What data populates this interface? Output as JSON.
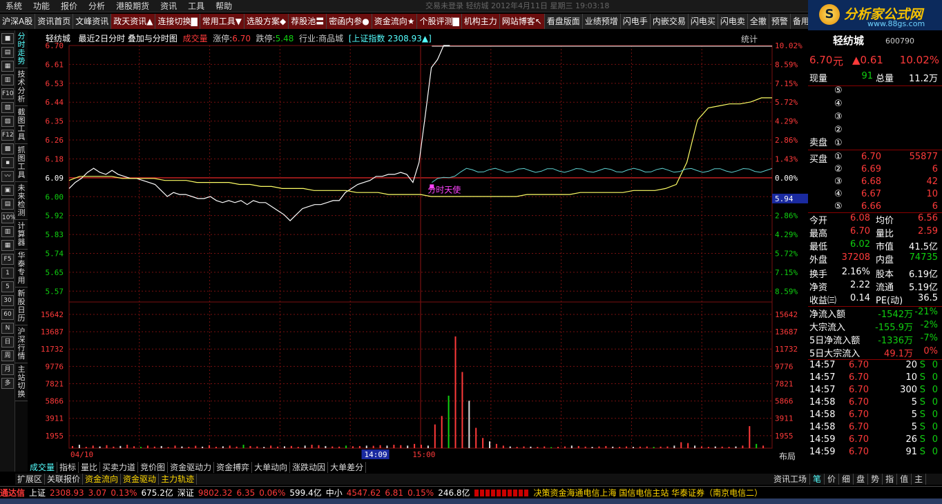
{
  "menu": [
    "系统",
    "功能",
    "报价",
    "分析",
    "港股期货",
    "资讯",
    "工具",
    "帮助"
  ],
  "window_title": "交易未登录  轻纺城  2012年4月11日  星期三  19:03:18",
  "toolbar": [
    "沪深A股",
    "资讯首页",
    "文峰资讯",
    "政天资讯▲",
    "连接切换▇",
    "常用工具▼",
    "选股方案◆",
    "荐股池〓",
    "密函内参●",
    "资金流向★",
    "个股评测▇",
    "机构主力",
    "网站博客↖",
    "看盘版面",
    "业绩预增",
    "闪电手",
    "内嵌交易",
    "闪电买",
    "闪电卖",
    "全撤",
    "预警",
    "备用"
  ],
  "logo": {
    "title": "分析家公式网",
    "url": "www.88gs.com",
    "mark": "S"
  },
  "left_icons": [
    "■",
    "▤",
    "▦",
    "▥",
    "F10",
    "▧",
    "▨",
    "F12",
    "▩",
    "▪",
    "〰",
    "▣",
    "▤",
    "10%",
    "▥",
    "▦",
    "F5",
    "1",
    "5",
    "30",
    "60",
    "N",
    "日",
    "周",
    "月",
    "多"
  ],
  "vertical_tabs": [
    "分时走势",
    "技术分析",
    "截图工具",
    "抓图工具",
    "未来检测",
    "计算器",
    "华泰专用",
    "新股日历",
    "沪深行情",
    "主站切换"
  ],
  "chart_header": {
    "stock": "轻纺城",
    "mode": "最近2日分时 叠加与分时图",
    "vol_label": "成交量",
    "up_limit_label": "涨停:",
    "up_limit": "6.70",
    "down_limit_label": "跌停:",
    "down_limit": "5.48",
    "industry": "行业:商品城",
    "index": "[上证指数 2308.93▲]",
    "stats": "统计"
  },
  "price_axis": [
    "6.70",
    "6.61",
    "6.53",
    "6.44",
    "6.35",
    "6.26",
    "6.18",
    "6.09",
    "6.00",
    "5.92",
    "5.83",
    "5.74",
    "5.65",
    "5.57"
  ],
  "pct_axis": [
    "10.02%",
    "8.59%",
    "7.15%",
    "5.72%",
    "4.29%",
    "2.86%",
    "1.43%",
    "0.00%",
    "1.43%",
    "2.86%",
    "4.29%",
    "5.72%",
    "7.15%",
    "8.59%"
  ],
  "vol_axis": [
    "15642",
    "13687",
    "11732",
    "9776",
    "7821",
    "5866",
    "3911",
    "1955"
  ],
  "time_labels": [
    "04/10",
    "14:09",
    "15:00"
  ],
  "cursor_price": "5.94",
  "annotation": "分时天使",
  "bottom_right_ctrl": "布局",
  "bottom_right_btns": [
    "+",
    "-",
    "0"
  ],
  "bottom_tabs": [
    "成交量",
    "指标",
    "量比",
    "买卖力道",
    "竞价图",
    "资金驱动力",
    "资金搏弈",
    "大单动向",
    "涨跌动因",
    "大单差分"
  ],
  "bottom_tabs2": [
    "扩展区",
    "关联报价",
    "资金流向",
    "资金驱动",
    "主力轨迹"
  ],
  "bottom_tabs2_right": "资讯工场",
  "right_tabs": [
    "笔",
    "价",
    "细",
    "盘",
    "势",
    "指",
    "值",
    "主"
  ],
  "quote": {
    "name": "轻纺城",
    "code": "600790",
    "price": "6.70",
    "unit": "元",
    "change": "▲0.61",
    "pct": "10.02%",
    "now_label": "现量",
    "now_val": "91",
    "total_label": "总量",
    "total_val": "11.2万",
    "sell_label": "卖盘",
    "buy_label": "买盘",
    "asks": [
      "⑤",
      "④",
      "③",
      "②",
      "①"
    ],
    "bids": [
      {
        "no": "①",
        "p": "6.70",
        "v": "55877"
      },
      {
        "no": "②",
        "p": "6.69",
        "v": "6"
      },
      {
        "no": "③",
        "p": "6.68",
        "v": "42"
      },
      {
        "no": "④",
        "p": "6.67",
        "v": "10"
      },
      {
        "no": "⑤",
        "p": "6.66",
        "v": "6"
      }
    ],
    "stats": [
      [
        "今开",
        "6.08",
        "均价",
        "6.56"
      ],
      [
        "最高",
        "6.70",
        "量比",
        "2.59"
      ],
      [
        "最低",
        "6.02",
        "市值",
        "41.5亿"
      ],
      [
        "外盘",
        "37208",
        "内盘",
        "74735"
      ],
      [
        "换手",
        "2.16%",
        "股本",
        "6.19亿"
      ],
      [
        "净资",
        "2.22",
        "流通",
        "5.19亿"
      ],
      [
        "收益㈢",
        "0.14",
        "PE(动)",
        "36.5"
      ]
    ],
    "flows": [
      [
        "净流入额",
        "-1542万",
        "-21%"
      ],
      [
        "大宗流入",
        "-155.9万",
        "-2%"
      ],
      [
        "5日净流入额",
        "-1336万",
        "-7%"
      ],
      [
        "5日大宗流入",
        "49.1万",
        "0%"
      ]
    ],
    "ticks": [
      [
        "14:57",
        "6.70",
        "20",
        "S",
        "0"
      ],
      [
        "14:57",
        "6.70",
        "10",
        "S",
        "0"
      ],
      [
        "14:57",
        "6.70",
        "300",
        "S",
        "0"
      ],
      [
        "14:58",
        "6.70",
        "5",
        "S",
        "0"
      ],
      [
        "14:58",
        "6.70",
        "5",
        "S",
        "0"
      ],
      [
        "14:58",
        "6.70",
        "5",
        "S",
        "0"
      ],
      [
        "14:59",
        "6.70",
        "26",
        "S",
        "0"
      ],
      [
        "14:59",
        "6.70",
        "91",
        "S",
        "0"
      ]
    ]
  },
  "status": {
    "brand": "通达信",
    "sh_name": "上证",
    "sh": "2308.93",
    "sh_chg": "3.07",
    "sh_pct": "0.13%",
    "sh_amt": "675.2亿",
    "sz_name": "深证",
    "sz": "9802.32",
    "sz_chg": "6.35",
    "sz_pct": "0.06%",
    "sz_amt": "599.4亿",
    "zx_name": "中小",
    "zx": "4547.62",
    "zx_chg": "6.81",
    "zx_pct": "0.15%",
    "zx_amt": "246.8亿",
    "news": "决策资金海通电信上海  国信电信主站  华泰证券（南京电信二）"
  },
  "colors": {
    "up": "#ff3a3a",
    "down": "#10d010",
    "price_line": "#ffffff",
    "avg_line": "#ffff66",
    "index_line": "#5fd3d3",
    "grid": "#7a1010"
  },
  "chart_data": {
    "type": "line",
    "x_range": [
      "04/10",
      "15:00"
    ],
    "ylim": [
      5.48,
      6.7
    ],
    "prev_close": 6.09,
    "series": [
      {
        "values": [
          5.99,
          6.02,
          6.04,
          6.07,
          6.09,
          6.07,
          6.06,
          6.08,
          6.06,
          6.05,
          6.04,
          6.04,
          6.03,
          6.02,
          6.01,
          5.98,
          5.95,
          5.97,
          5.96,
          5.96,
          5.95,
          5.94,
          5.94,
          5.95,
          5.93,
          5.92,
          5.93,
          5.92,
          5.93,
          5.91,
          5.93,
          5.92,
          5.92,
          5.9,
          5.88,
          5.86,
          5.83,
          5.86,
          5.89,
          5.9,
          5.91,
          5.91,
          5.92,
          5.93,
          5.93,
          5.97,
          5.99,
          6.01,
          6.02,
          6.03,
          6.05,
          6.05,
          6.06,
          6.06,
          6.07,
          6.06,
          6.02,
          6.12,
          6.35,
          6.59,
          6.63,
          6.7,
          6.7
        ]
      },
      {
        "values": [
          6.03,
          6.05,
          6.05,
          6.05,
          6.05,
          6.04,
          6.04,
          6.04,
          6.04,
          6.03,
          6.03,
          6.03,
          6.02,
          6.02,
          6.02,
          6.02,
          6.01,
          6.01,
          6.0,
          6.0,
          5.99,
          5.99,
          5.99,
          5.98,
          5.98,
          5.98,
          5.98,
          5.97,
          5.97,
          5.97,
          5.96,
          5.96,
          5.96,
          5.96,
          5.95,
          5.95,
          5.95,
          5.95,
          5.95,
          5.95,
          5.95,
          5.95,
          5.95,
          5.96,
          5.96,
          5.96,
          5.96,
          5.96,
          5.97,
          5.97,
          5.97,
          5.97,
          5.97,
          5.98,
          5.98,
          5.98,
          5.99,
          6.01,
          6.12,
          6.33,
          6.39,
          6.4,
          6.41,
          6.41,
          6.42,
          6.44,
          6.44
        ]
      }
    ],
    "volume_max": 15642,
    "volume": [
      250,
      400,
      150,
      300,
      200,
      350,
      180,
      260,
      400,
      220,
      150,
      300,
      180,
      250,
      120,
      300,
      200,
      150,
      280,
      180,
      350,
      160,
      220,
      300,
      180,
      400,
      250,
      200,
      150,
      300,
      180,
      220,
      260,
      150,
      300,
      400,
      350,
      250,
      200,
      180,
      300,
      220,
      250,
      300,
      280,
      350,
      300,
      400,
      350,
      300,
      500,
      400,
      300,
      2800,
      3800,
      6200,
      13200,
      9000,
      5600,
      2400,
      1200,
      800,
      500,
      300,
      200,
      150,
      200,
      180,
      150,
      200,
      120,
      150,
      200,
      300,
      250,
      180,
      150,
      200,
      250,
      180,
      150,
      200,
      150,
      180,
      200,
      150,
      180,
      200,
      300,
      700,
      600,
      300,
      200,
      150,
      200,
      180,
      150,
      200,
      300,
      2600,
      500,
      300
    ]
  }
}
